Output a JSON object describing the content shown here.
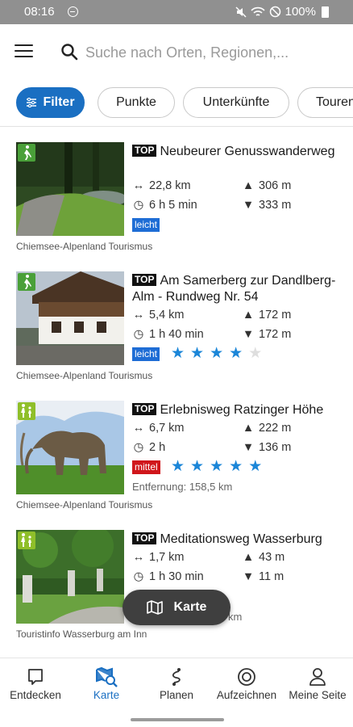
{
  "status_bar": {
    "time": "08:16",
    "battery": "100%"
  },
  "search": {
    "placeholder": "Suche nach Orten, Regionen,..."
  },
  "chips": [
    {
      "label": "Filter",
      "active": true
    },
    {
      "label": "Punkte"
    },
    {
      "label": "Unterkünfte"
    },
    {
      "label": "Touren"
    }
  ],
  "tours": [
    {
      "badge": "TOP",
      "title": "Neubeurer Genusswanderweg",
      "distance": "22,8 km",
      "duration": "6 h 5 min",
      "ascent": "306 m",
      "descent": "333 m",
      "difficulty": "leicht",
      "rating": null,
      "distance_from": null,
      "source": "Chiemsee-Alpenland Tourismus",
      "type_icon": "hiking-icon"
    },
    {
      "badge": "TOP",
      "title": "Am Samerberg zur Dandlberg-Alm - Rundweg Nr. 54",
      "distance": "5,4 km",
      "duration": "1 h 40 min",
      "ascent": "172 m",
      "descent": "172 m",
      "difficulty": "leicht",
      "rating": 4,
      "distance_from": null,
      "source": "Chiemsee-Alpenland Tourismus",
      "type_icon": "hiking-icon"
    },
    {
      "badge": "TOP",
      "title": "Erlebnisweg Ratzinger Höhe",
      "distance": "6,7 km",
      "duration": "2 h",
      "ascent": "222 m",
      "descent": "136 m",
      "difficulty": "mittel",
      "rating": 5,
      "distance_from": "Entfernung: 158,5 km",
      "source": "Chiemsee-Alpenland Tourismus",
      "type_icon": "family-hiking-icon"
    },
    {
      "badge": "TOP",
      "title": "Meditationsweg Wasserburg",
      "distance": "1,7 km",
      "duration": "1 h 30 min",
      "ascent": "43 m",
      "descent": "11 m",
      "difficulty": null,
      "rating": null,
      "distance_from": "km",
      "source": "Touristinfo Wasserburg am Inn",
      "type_icon": "family-hiking-icon"
    }
  ],
  "map_button": {
    "label": "Karte"
  },
  "bottom_nav": [
    {
      "label": "Entdecken",
      "icon": "discover-icon"
    },
    {
      "label": "Karte",
      "icon": "map-search-icon",
      "active": true
    },
    {
      "label": "Planen",
      "icon": "route-icon"
    },
    {
      "label": "Aufzeichnen",
      "icon": "record-icon"
    },
    {
      "label": "Meine Seite",
      "icon": "person-icon"
    }
  ],
  "colors": {
    "accent": "#1a6fc2",
    "leicht": "#1e6dd5",
    "mittel": "#d0161b",
    "hiking_green": "#4aa039",
    "star": "#1b86d8"
  }
}
